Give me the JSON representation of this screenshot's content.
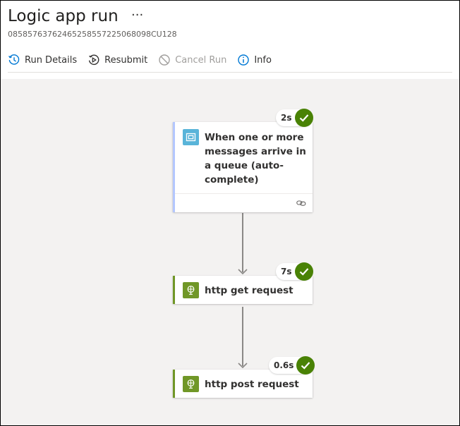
{
  "header": {
    "title": "Logic app run",
    "more_label": "···",
    "run_id": "08585763762465258557225068098CU128"
  },
  "toolbar": {
    "run_details_label": "Run Details",
    "resubmit_label": "Resubmit",
    "cancel_run_label": "Cancel Run",
    "info_label": "Info"
  },
  "workflow": {
    "steps": [
      {
        "label": "When one or more messages arrive in a queue (auto-complete)",
        "duration": "2s",
        "status": "succeeded",
        "icon": "service-bus-icon"
      },
      {
        "label": "http get request",
        "duration": "7s",
        "status": "succeeded",
        "icon": "http-icon"
      },
      {
        "label": "http post request",
        "duration": "0.6s",
        "status": "succeeded",
        "icon": "http-icon"
      }
    ]
  },
  "colors": {
    "success": "#498205",
    "trigger_accent": "#b4c7fe",
    "http_accent": "#709727",
    "trigger_icon_bg": "#59b4d9",
    "http_icon_bg": "#709727"
  }
}
